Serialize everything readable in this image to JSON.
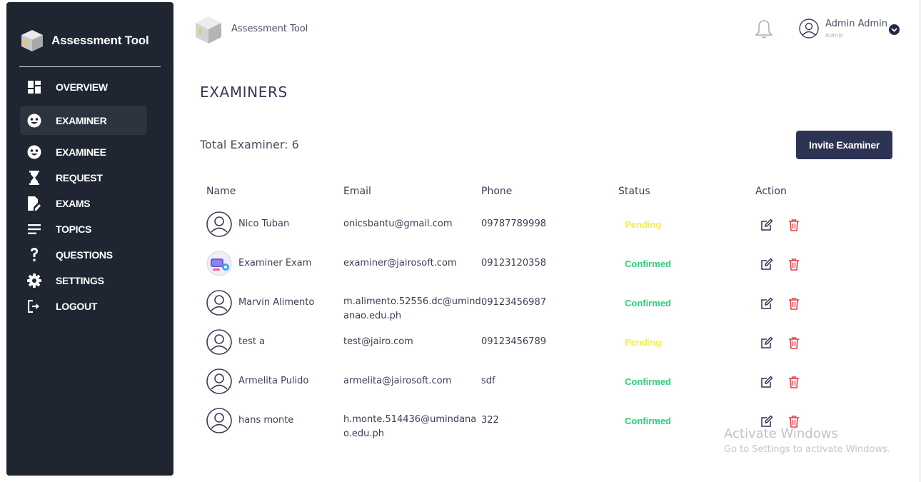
{
  "sidebar": {
    "brand_title": "Assessment Tool",
    "items": [
      {
        "label": "OVERVIEW",
        "icon": "dashboard-icon"
      },
      {
        "label": "EXAMINER",
        "icon": "smiley-icon",
        "active": true
      },
      {
        "label": "EXAMINEE",
        "icon": "smiley-icon"
      },
      {
        "label": "REQUEST",
        "icon": "hourglass-icon"
      },
      {
        "label": "EXAMS",
        "icon": "edit-document-icon"
      },
      {
        "label": "TOPICS",
        "icon": "lines-icon"
      },
      {
        "label": "QUESTIONS",
        "icon": "question-mark-icon"
      },
      {
        "label": "SETTINGS",
        "icon": "gear-icon"
      },
      {
        "label": "LOGOUT",
        "icon": "logout-icon"
      }
    ]
  },
  "header": {
    "app_title": "Assessment Tool",
    "user_name": "Admin Admin",
    "user_role": "Admin"
  },
  "main": {
    "page_title": "EXAMINERS",
    "total_label": "Total Examiner: 6",
    "invite_button": "Invite Examiner",
    "columns": [
      "Name",
      "Email",
      "Phone",
      "Status",
      "Action"
    ],
    "rows": [
      {
        "name": "Nico Tuban",
        "email": "onicsbantu@gmail.com",
        "phone": "09787789998",
        "status": "Pending",
        "avatar": "default"
      },
      {
        "name": "Examiner Exam",
        "email": "examiner@jairosoft.com",
        "phone": "09123120358",
        "status": "Confirmed",
        "avatar": "photo"
      },
      {
        "name": "Marvin Alimento",
        "email": "m.alimento.52556.dc@umindanao.edu.ph",
        "phone": "09123456987",
        "status": "Confirmed",
        "avatar": "default"
      },
      {
        "name": "test a",
        "email": "test@jairo.com",
        "phone": "09123456789",
        "status": "Pending",
        "avatar": "default"
      },
      {
        "name": "Armelita Pulido",
        "email": "armelita@jairosoft.com",
        "phone": "sdf",
        "status": "Confirmed",
        "avatar": "default"
      },
      {
        "name": "hans monte",
        "email": "h.monte.514436@umindanao.edu.ph",
        "phone": "322",
        "status": "Confirmed",
        "avatar": "default"
      }
    ]
  },
  "watermark": {
    "line1": "Activate Windows",
    "line2": "Go to Settings to activate Windows."
  },
  "colors": {
    "sidebar_bg": "#1f2631",
    "pending": "#f3ef4a",
    "confirmed": "#2dcf7d",
    "delete": "#e2434b",
    "primary_button": "#2d3352"
  }
}
